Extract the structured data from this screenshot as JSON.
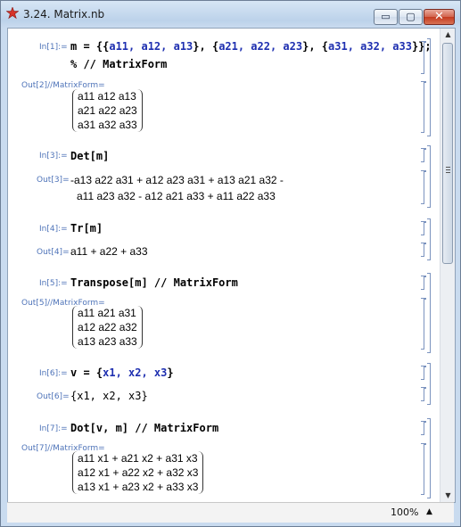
{
  "window": {
    "title": "3.24. Matrix.nb",
    "min_glyph": "▭",
    "max_glyph": "▢",
    "close_glyph": "✕"
  },
  "status": {
    "zoom": "100%",
    "zoom_arrow": "▲"
  },
  "scrollbar": {
    "up": "▲",
    "down": "▼"
  },
  "cells": {
    "c1": {
      "in_label": "In[1]:=",
      "line1_a": "m = {{",
      "line1_b": "a11, a12, a13",
      "line1_c": "}, {",
      "line1_d": "a21, a22, a23",
      "line1_e": "}, {",
      "line1_f": "a31, a32, a33",
      "line1_g": "}};",
      "line2": "% // MatrixForm",
      "out_label": "Out[2]//MatrixForm=",
      "rows": [
        "a11  a12  a13",
        "a21  a22  a23",
        "a31  a32  a33"
      ]
    },
    "c3": {
      "in_label": "In[3]:=",
      "input": "Det[m]",
      "out_label": "Out[3]=",
      "out1": "-a13 a22 a31 + a12 a23 a31 + a13 a21 a32 -",
      "out2": "a11 a23 a32 - a12 a21 a33 + a11 a22 a33"
    },
    "c4": {
      "in_label": "In[4]:=",
      "input": "Tr[m]",
      "out_label": "Out[4]=",
      "out": "a11 + a22 + a33"
    },
    "c5": {
      "in_label": "In[5]:=",
      "input": "Transpose[m] // MatrixForm",
      "out_label": "Out[5]//MatrixForm=",
      "rows": [
        "a11  a21  a31",
        "a12  a22  a32",
        "a13  a23  a33"
      ]
    },
    "c6": {
      "in_label": "In[6]:=",
      "input_a": "v = {",
      "input_b": "x1, x2, x3",
      "input_c": "}",
      "out_label": "Out[6]=",
      "out": "{x1, x2, x3}"
    },
    "c7": {
      "in_label": "In[7]:=",
      "input": "Dot[v, m] // MatrixForm",
      "out_label": "Out[7]//MatrixForm=",
      "rows": [
        "a11 x1 + a21 x2 + a31 x3",
        "a12 x1 + a22 x2 + a32 x3",
        "a13 x1 + a23 x2 + a33 x3"
      ]
    }
  }
}
